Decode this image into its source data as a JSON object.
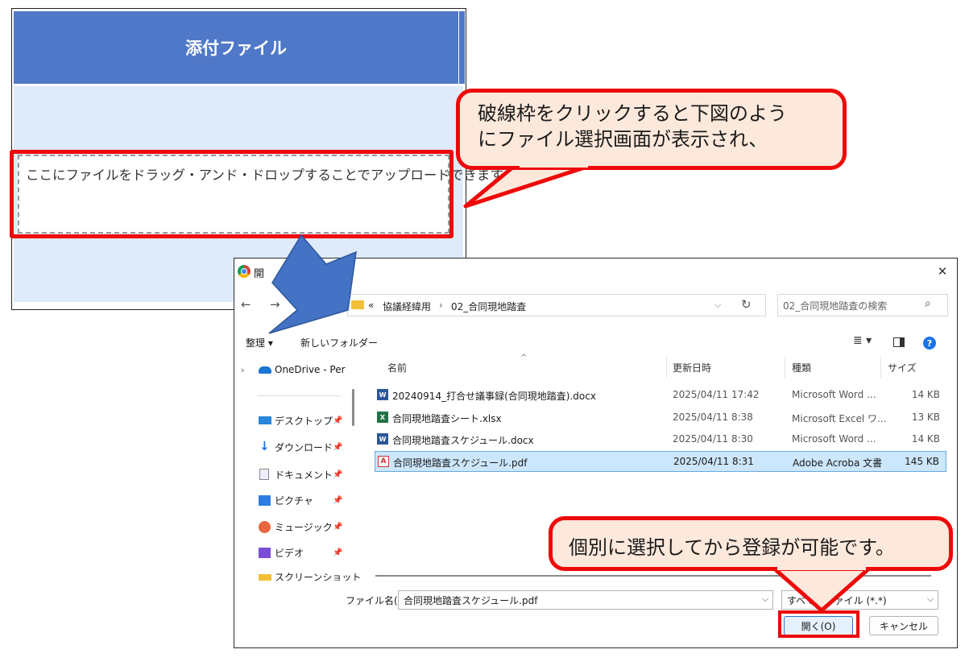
{
  "upload": {
    "header": "添付ファイル",
    "drop_text": "ここにファイルをドラッグ・アンド・ドロップすることでアップロードできます。"
  },
  "callouts": {
    "top_line1": "破線枠をクリックすると下図のよう",
    "top_line2": "にファイル選択画面が表示され、",
    "bottom": "個別に選択してから登録が可能です。"
  },
  "dialog": {
    "title": "開",
    "close_glyph": "✕",
    "breadcrumb": {
      "overflow": "«",
      "parent": "協議経緯用",
      "separator": "›",
      "current": "02_合同現地踏査"
    },
    "search_placeholder": "02_合同現地踏査の検索",
    "toolbar": {
      "organize": "整理 ▾",
      "new_folder": "新しいフォルダー"
    },
    "columns": {
      "name": "名前",
      "modified": "更新日時",
      "type": "種類",
      "size": "サイズ"
    },
    "files": [
      {
        "name": "20240914_打合せ議事録(合同現地踏査).docx",
        "modified": "2025/04/11 17:42",
        "type": "Microsoft Word ...",
        "size": "14 KB",
        "icon": "word-icon"
      },
      {
        "name": "合同現地踏査シート.xlsx",
        "modified": "2025/04/11 8:38",
        "type": "Microsoft Excel ワ...",
        "size": "13 KB",
        "icon": "excel-icon"
      },
      {
        "name": "合同現地踏査スケジュール.docx",
        "modified": "2025/04/11 8:30",
        "type": "Microsoft Word ...",
        "size": "14 KB",
        "icon": "word-icon"
      },
      {
        "name": "合同現地踏査スケジュール.pdf",
        "modified": "2025/04/11 8:31",
        "type": "Adobe Acroba 文書",
        "size": "145 KB",
        "icon": "pdf-icon",
        "selected": true
      }
    ],
    "sidebar": {
      "onedrive": "OneDrive - Pers",
      "items": [
        {
          "label": "デスクトップ",
          "icon": "desktop-icon"
        },
        {
          "label": "ダウンロード",
          "icon": "download-icon"
        },
        {
          "label": "ドキュメント",
          "icon": "document-icon"
        },
        {
          "label": "ピクチャ",
          "icon": "picture-icon"
        },
        {
          "label": "ミュージック",
          "icon": "music-icon"
        },
        {
          "label": "ビデオ",
          "icon": "video-icon"
        },
        {
          "label": "スクリーンショット",
          "icon": "folder-icon"
        }
      ]
    },
    "filename_label": "ファイル名(N):",
    "filename_value": "合同現地踏査スケジュール.pdf",
    "filter_value": "すべてのファイル (*.*)",
    "open_button": "開く(O)",
    "cancel_button": "キャンセル"
  },
  "colors": {
    "accent": "#4f78c8",
    "highlight_red": "#ee0a0a",
    "callout_fill": "#fde9dc",
    "arrow_blue": "#4472c4"
  }
}
